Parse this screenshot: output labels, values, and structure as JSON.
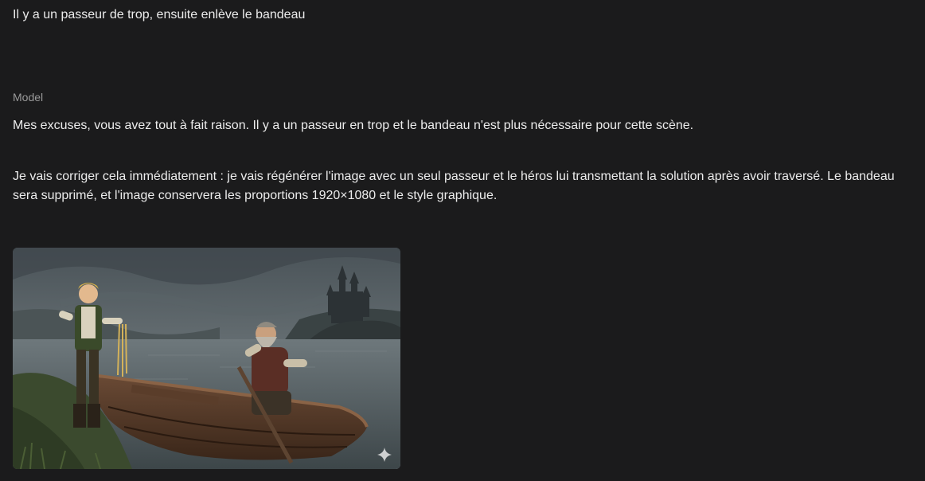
{
  "user_message": "Il y a un passeur de trop, ensuite enlève le bandeau",
  "model": {
    "label": "Model",
    "paragraphs": [
      "Mes excuses, vous avez tout à fait raison. Il y a un passeur en trop et le bandeau n'est plus nécessaire pour cette scène.",
      "Je vais corriger cela immédiatement : je vais régénérer l'image avec un seul passeur et le héros lui transmettant la solution après avoir traversé. Le bandeau sera supprimé, et l'image conservera les proportions 1920×1080 et le style graphique."
    ]
  },
  "image": {
    "icon": "sparkle-icon"
  }
}
